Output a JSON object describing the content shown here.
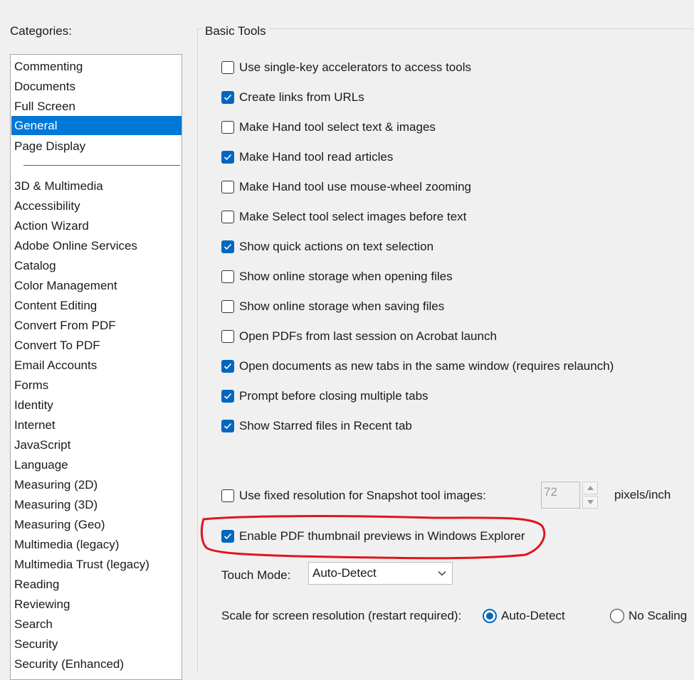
{
  "categories_label": "Categories:",
  "categories": {
    "top": [
      "Commenting",
      "Documents",
      "Full Screen",
      "General",
      "Page Display"
    ],
    "selected": "General",
    "rest": [
      "3D & Multimedia",
      "Accessibility",
      "Action Wizard",
      "Adobe Online Services",
      "Catalog",
      "Color Management",
      "Content Editing",
      "Convert From PDF",
      "Convert To PDF",
      "Email Accounts",
      "Forms",
      "Identity",
      "Internet",
      "JavaScript",
      "Language",
      "Measuring (2D)",
      "Measuring (3D)",
      "Measuring (Geo)",
      "Multimedia (legacy)",
      "Multimedia Trust (legacy)",
      "Reading",
      "Reviewing",
      "Search",
      "Security",
      "Security (Enhanced)"
    ]
  },
  "basic_tools": {
    "title": "Basic Tools",
    "options": [
      {
        "label": "Use single-key accelerators to access tools",
        "checked": false
      },
      {
        "label": "Create links from URLs",
        "checked": true
      },
      {
        "label": "Make Hand tool select text & images",
        "checked": false
      },
      {
        "label": "Make Hand tool read articles",
        "checked": true
      },
      {
        "label": "Make Hand tool use mouse-wheel zooming",
        "checked": false
      },
      {
        "label": "Make Select tool select images before text",
        "checked": false
      },
      {
        "label": "Show quick actions on text selection",
        "checked": true
      },
      {
        "label": "Show online storage when opening files",
        "checked": false
      },
      {
        "label": "Show online storage when saving files",
        "checked": false
      },
      {
        "label": "Open PDFs from last session on Acrobat launch",
        "checked": false
      },
      {
        "label": "Open documents as new tabs in the same window (requires relaunch)",
        "checked": true
      },
      {
        "label": "Prompt before closing multiple tabs",
        "checked": true
      },
      {
        "label": "Show Starred files in Recent tab",
        "checked": true
      }
    ]
  },
  "snapshot": {
    "label": "Use fixed resolution for Snapshot tool images:",
    "checked": false,
    "value": "72",
    "units": "pixels/inch"
  },
  "thumbnail": {
    "label": "Enable PDF thumbnail previews in Windows Explorer",
    "checked": true,
    "annotation_color": "#e0141e"
  },
  "touch_mode": {
    "label": "Touch Mode:",
    "value": "Auto-Detect"
  },
  "scale": {
    "label": "Scale for screen resolution (restart required):",
    "options": [
      {
        "label": "Auto-Detect",
        "selected": true
      },
      {
        "label": "No Scaling",
        "selected": false
      }
    ]
  },
  "colors": {
    "selection": "#0078d7",
    "checkbox_accent": "#0067c0",
    "background": "#f0f0f0"
  },
  "icons": {
    "checkbox": "checkmark-icon",
    "spinner_up": "caret-up-icon",
    "spinner_down": "caret-down-icon",
    "dropdown": "chevron-down-icon"
  }
}
